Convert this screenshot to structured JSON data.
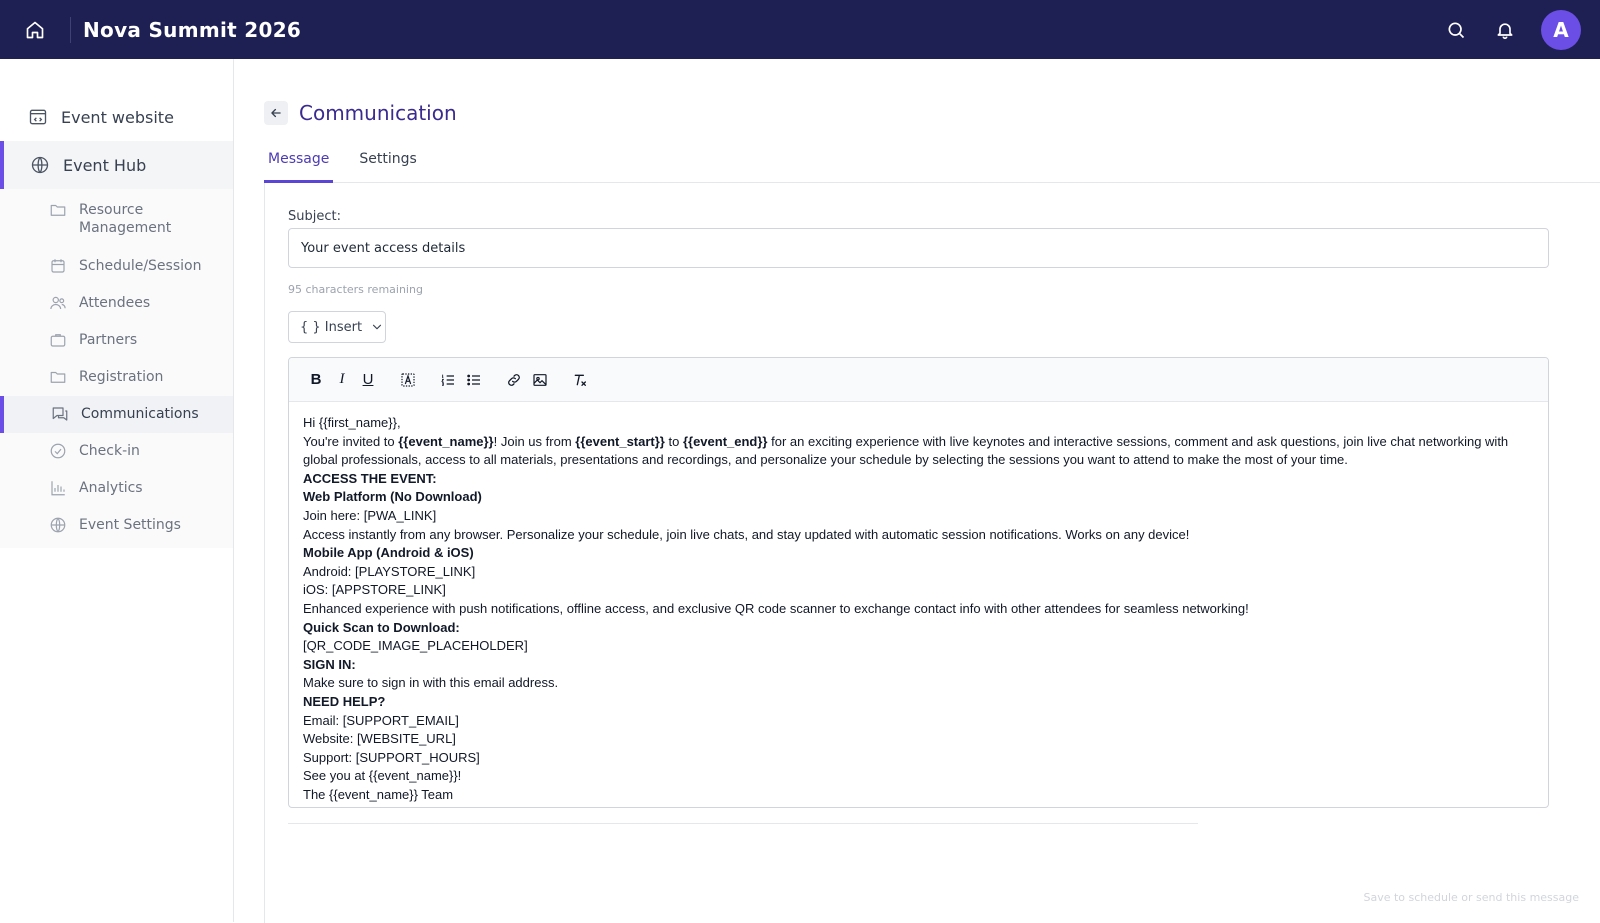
{
  "app": {
    "title": "Nova Summit 2026",
    "avatar_initial": "A",
    "brand_color": "#1e1f52",
    "accent_color": "#6b4ee6"
  },
  "topbar_icons": [
    "home-icon",
    "search-icon",
    "bell-icon"
  ],
  "sidebar": {
    "main_items": [
      {
        "label": "Event website",
        "icon": "website-icon"
      },
      {
        "label": "Event Hub",
        "icon": "globe-icon",
        "active": true
      }
    ],
    "sub_items": [
      {
        "label": "Resource Management",
        "icon": "folder-icon"
      },
      {
        "label": "Schedule/Session",
        "icon": "calendar-icon"
      },
      {
        "label": "Attendees",
        "icon": "users-icon"
      },
      {
        "label": "Partners",
        "icon": "briefcase-icon"
      },
      {
        "label": "Registration",
        "icon": "folder-icon"
      },
      {
        "label": "Communications",
        "icon": "chat-icon",
        "active": true
      },
      {
        "label": "Check-in",
        "icon": "check-circle-icon"
      },
      {
        "label": "Analytics",
        "icon": "bar-chart-icon"
      },
      {
        "label": "Event Settings",
        "icon": "globe-icon"
      }
    ]
  },
  "page": {
    "title": "Communication",
    "tabs": [
      {
        "label": "Message",
        "active": true
      },
      {
        "label": "Settings",
        "active": false
      }
    ]
  },
  "form": {
    "subject_label": "Subject:",
    "subject_value": "Your event access details",
    "chars_remaining": "95 characters remaining",
    "insert_label": "{ } Insert"
  },
  "editor": {
    "toolbar": [
      "bold",
      "italic",
      "underline",
      "text-color",
      "ordered-list",
      "bullet-list",
      "link",
      "image",
      "clear-format"
    ],
    "lines": [
      {
        "segments": [
          {
            "t": "Hi {{first_name}},"
          }
        ]
      },
      {
        "segments": [
          {
            "t": "You're invited to "
          },
          {
            "t": "{{event_name}}",
            "b": true
          },
          {
            "t": "! Join us from "
          },
          {
            "t": "{{event_start}}",
            "b": true
          },
          {
            "t": " to "
          },
          {
            "t": "{{event_end}}",
            "b": true
          },
          {
            "t": " for an exciting experience with live keynotes and interactive sessions, comment and ask questions, join live chat networking with global professionals, access to all materials, presentations and recordings, and personalize your schedule by selecting the sessions you want to attend to make the most of your time."
          }
        ]
      },
      {
        "segments": [
          {
            "t": "ACCESS THE EVENT:",
            "b": true
          }
        ]
      },
      {
        "segments": [
          {
            "t": "Web Platform (No Download)",
            "b": true
          }
        ]
      },
      {
        "segments": [
          {
            "t": "Join here: [PWA_LINK]"
          }
        ]
      },
      {
        "segments": [
          {
            "t": "Access instantly from any browser. Personalize your schedule, join live chats, and stay updated with automatic session notifications. Works on any device!"
          }
        ]
      },
      {
        "segments": [
          {
            "t": "Mobile App (Android & iOS)",
            "b": true
          }
        ]
      },
      {
        "segments": [
          {
            "t": "Android: [PLAYSTORE_LINK]"
          }
        ]
      },
      {
        "segments": [
          {
            "t": "iOS: [APPSTORE_LINK]"
          }
        ]
      },
      {
        "segments": [
          {
            "t": "Enhanced experience with push notifications, offline access, and exclusive QR code scanner to exchange contact info with other attendees for seamless networking!"
          }
        ]
      },
      {
        "segments": [
          {
            "t": "Quick Scan to Download:",
            "b": true
          }
        ]
      },
      {
        "segments": [
          {
            "t": "[QR_CODE_IMAGE_PLACEHOLDER]"
          }
        ]
      },
      {
        "segments": [
          {
            "t": "SIGN IN:",
            "b": true
          }
        ]
      },
      {
        "segments": [
          {
            "t": "Make sure to sign in with this email address."
          }
        ]
      },
      {
        "segments": [
          {
            "t": "NEED HELP?",
            "b": true
          }
        ]
      },
      {
        "segments": [
          {
            "t": "Email: [SUPPORT_EMAIL]"
          }
        ]
      },
      {
        "segments": [
          {
            "t": "Website: [WEBSITE_URL]"
          }
        ]
      },
      {
        "segments": [
          {
            "t": "Support: [SUPPORT_HOURS]"
          }
        ]
      },
      {
        "segments": [
          {
            "t": "See you at {{event_name}}!"
          }
        ]
      },
      {
        "segments": [
          {
            "t": "The {{event_name}} Team"
          }
        ]
      }
    ]
  },
  "footer": {
    "hint": "Save to schedule or send this message"
  }
}
